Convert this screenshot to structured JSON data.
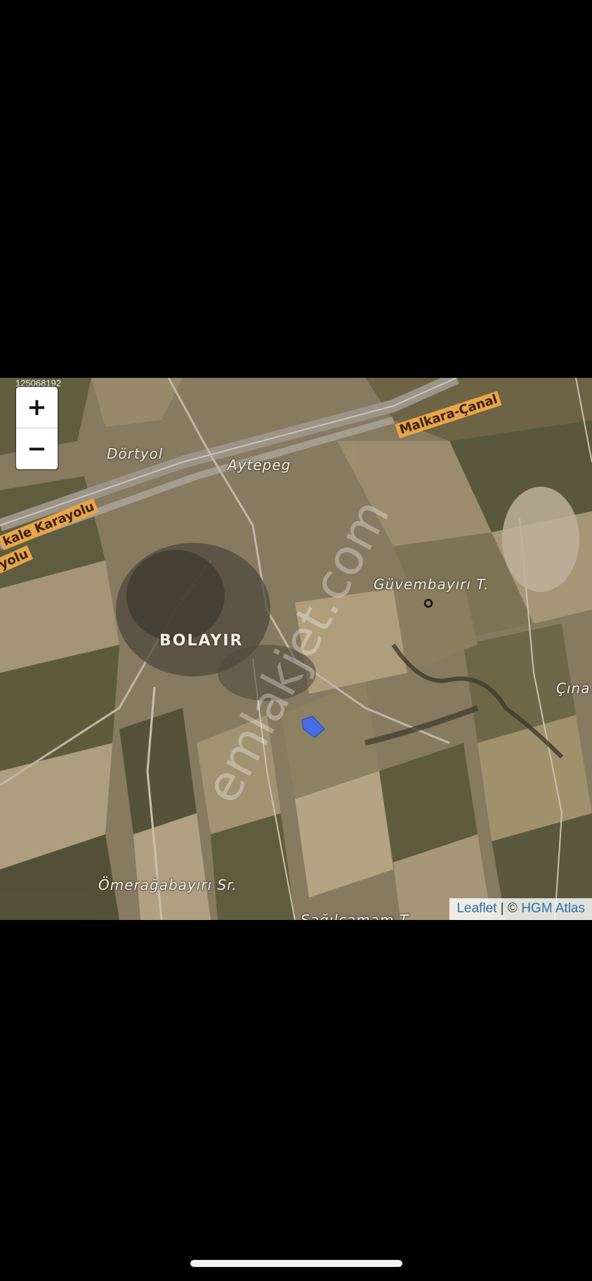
{
  "map": {
    "id_text": "125068192",
    "zoom_in_label": "+",
    "zoom_out_label": "−",
    "attribution": {
      "leaflet": "Leaflet",
      "separator": " | © ",
      "provider": "HGM Atlas"
    },
    "watermark": "emlakjet.com",
    "place_labels": {
      "dortyol": "Dörtyol",
      "aytepe": "Aytepeg",
      "bolayir": "BOLAYIR",
      "guvembayiri": "Güvembayırı T.",
      "omeragabayiri": "Ömerağabayırı Sr.",
      "cina": "Çına",
      "bottom_cut": "Sağılçamam T"
    },
    "road_labels": {
      "malkara": "Malkara-Çanal",
      "karayolu": "kale Karayolu",
      "yolu": "yolu"
    },
    "colors": {
      "parcel": "#3f6df0",
      "road_badge": "#e9a54a",
      "attribution_link": "#2f6fa8"
    }
  }
}
